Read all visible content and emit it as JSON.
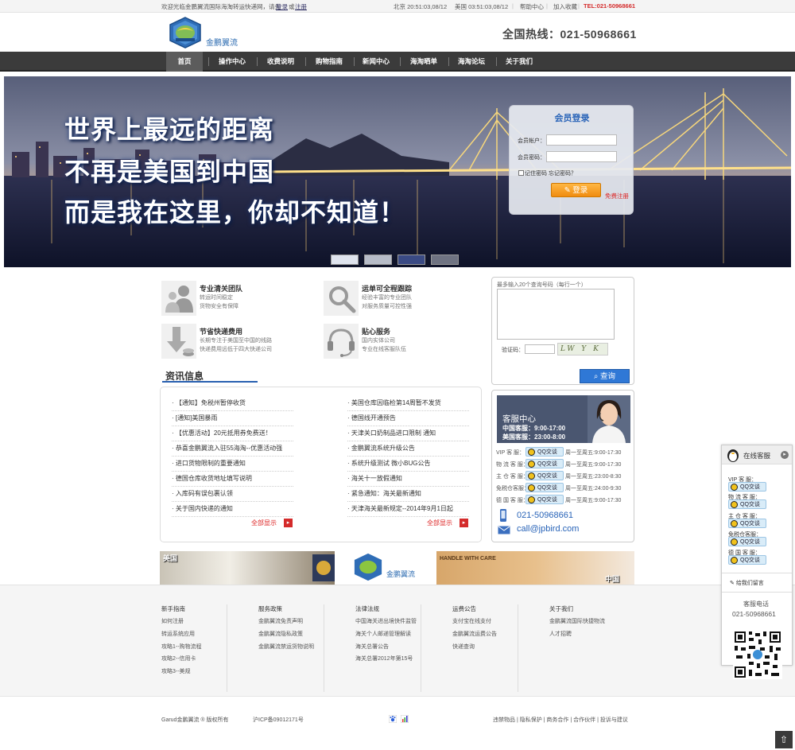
{
  "topbar": {
    "welcome_prefix": "欢迎光临金鹏翼流国际海淘转运快递网，请先",
    "login_link": "登录",
    "or_text": "或",
    "register_link": "注册",
    "beijing_time": "北京 20:51:03,08/12",
    "us_time": "美国 03:51:03,08/12",
    "help": "帮助中心",
    "favorite": "加入收藏",
    "tel": "TEL:021-50968661"
  },
  "header": {
    "logo_text": "金鹏翼流",
    "hotline": "全国热线：021-50968661"
  },
  "nav": {
    "items": [
      "首页",
      "操作中心",
      "收费说明",
      "购物指南",
      "新闻中心",
      "海淘晒单",
      "海淘论坛",
      "关于我们"
    ]
  },
  "banner": {
    "line1": "世界上最远的距离",
    "line2": "不再是美国到中国",
    "line3": "而是我在这里，你却不知道！"
  },
  "login": {
    "title": "会员登录",
    "account_label": "会员帐户：",
    "password_label": "会员密码：",
    "remember": "记住密码 忘记密码？",
    "submit": "登录",
    "register": "免费注册"
  },
  "features": [
    {
      "title": "专业清关团队",
      "desc1": "转运时间稳定",
      "desc2": "货物安全有保障"
    },
    {
      "title": "运单可全程跟踪",
      "desc1": "经验丰富的专业团队",
      "desc2": "对服务质量可控性强"
    },
    {
      "title": "节省快递费用",
      "desc1": "长期专注于美国至中国的线路",
      "desc2": "快递费用远低于四大快递公司"
    },
    {
      "title": "贴心服务",
      "desc1": "国内实体公司",
      "desc2": "专业在线客服队伍"
    }
  ],
  "query": {
    "hint": "最多输入20个查询号码（每行一个）",
    "captcha_label": "验证码：",
    "captcha_text": "LW Y K",
    "button": "查询"
  },
  "news": {
    "heading": "资讯信息",
    "left": [
      "【通知】免税州暂停收货",
      "[通知]美国暴雨",
      "【优惠活动】20元抵用券免费送！",
      "恭喜金鹏翼流入驻55海淘--优惠活动强",
      "进口货物限制的重要通知",
      "德国仓库收货地址填写说明",
      "入库码有误包裹认领",
      "关于国内快递的通知"
    ],
    "right": [
      "美国仓库因临检第14周暂不发货",
      "德国线开通预告",
      "天津关口奶制品进口限制 通知",
      "金鹏翼流系统升级公告",
      "系统升级测试 微小BUG公告",
      "海关十一放假通知",
      "紧急通知：海关最新通知",
      "天津海关最新规定--2014年9月1日起"
    ],
    "more": "全部显示"
  },
  "service": {
    "title": "客服中心",
    "cn_hours": "中国客服：9:00-17:00",
    "us_hours": "美国客服：23:00-8:00",
    "qq": "QQ交谈",
    "rows": [
      {
        "label": "VIP 客 服：",
        "hours": "周一至周五:9:00-17:30"
      },
      {
        "label": "物 流 客 服：",
        "hours": "周一至周五:9:00-17:30"
      },
      {
        "label": "主 仓 客 服：",
        "hours": "周一至周五:23:00-8:30"
      },
      {
        "label": "免税仓客服：",
        "hours": "周一至周五:24:00-9:30"
      },
      {
        "label": "德 国 客 服：",
        "hours": "周一至周五:9:00-17:30"
      }
    ],
    "phone": "021-50968661",
    "email": "call@jpbird.com"
  },
  "strip": {
    "usa": "美国",
    "china": "中国",
    "logo_text": "金鹏翼流",
    "box_label": "HANDLE WITH CARE"
  },
  "footer": {
    "columns": [
      {
        "title": "新手指南",
        "links": [
          "如何注册",
          "转运系统应用",
          "攻略1--购物流程",
          "攻略2--信用卡",
          "攻略3--美规"
        ]
      },
      {
        "title": "服务政策",
        "links": [
          "金鹏翼流免责声明",
          "金鹏翼流隐私政策",
          "金鹏翼流禁运货物说明"
        ]
      },
      {
        "title": "法律法规",
        "links": [
          "中国海关进出境快件监管",
          "海关个人邮递管理解读",
          "海关总署公告",
          "海关总署2012年第15号"
        ]
      },
      {
        "title": "运费公告",
        "links": [
          "支付宝在线支付",
          "金鹏翼流运费公告",
          "快递查询"
        ]
      },
      {
        "title": "关于我们",
        "links": [
          "金鹏翼流国际快捷物流",
          "人才招聘"
        ]
      }
    ]
  },
  "bottom": {
    "copyright": "Garud金鹏翼流 ® 版权所有",
    "icp": "沪ICP备09012171号",
    "links": "违禁物品 | 隐私保护 | 商务合作 | 合作伙伴 | 投诉与建议"
  },
  "sidebar": {
    "title": "在线客服",
    "groups": [
      "VIP 客 服：",
      "物 流 客 服：",
      "主 仓 客 服：",
      "免税仓客服：",
      "德 国 客 服："
    ],
    "qq": "QQ交谈",
    "leave_msg": "给我们留言",
    "phone_label": "客服电话",
    "phone": "021-50968661"
  },
  "colors": {
    "accent": "#2964b8",
    "nav_bg": "#3b3b3b",
    "tel_red": "#d42b2b",
    "login_orange": "#f39a1e"
  }
}
